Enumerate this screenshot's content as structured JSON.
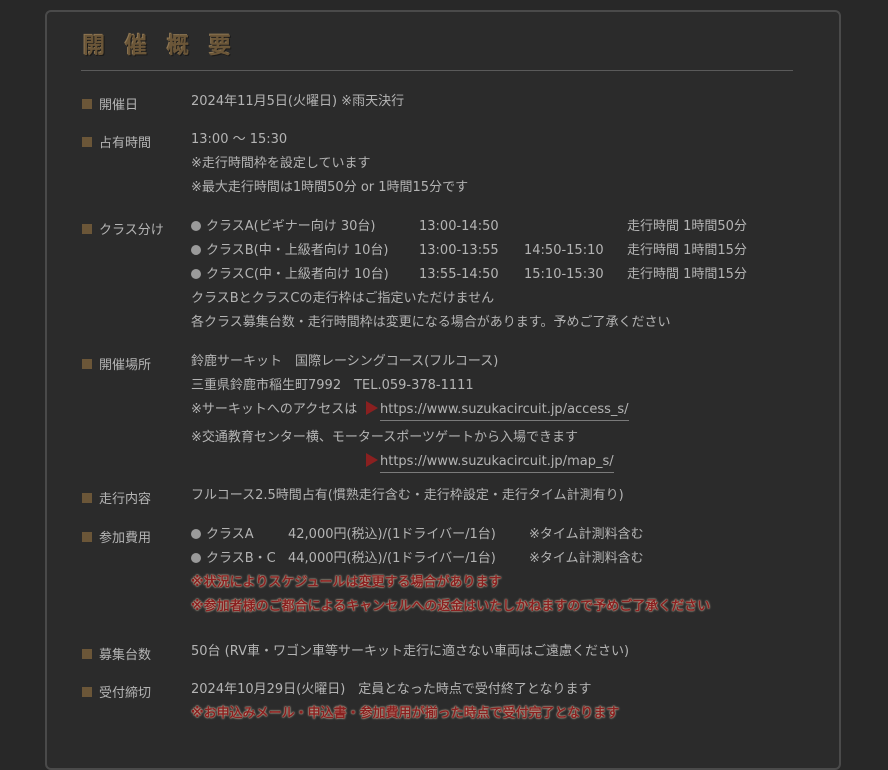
{
  "title": "開催概要",
  "sections": {
    "date": {
      "label": "開催日",
      "value": "2024年11月5日(火曜日) ※雨天決行"
    },
    "time": {
      "label": "占有時間",
      "lines": [
        "13:00 ～ 15:30",
        "※走行時間枠を設定しています",
        "※最大走行時間は1時間50分 or 1時間15分です"
      ]
    },
    "classes": {
      "label": "クラス分け",
      "rows": [
        {
          "name": "クラスA(ビギナー向け 30台)",
          "slot1": "13:00-14:50",
          "slot2": "",
          "duration": "走行時間 1時間50分"
        },
        {
          "name": "クラスB(中・上級者向け 10台)",
          "slot1": "13:00-13:55",
          "slot2": "14:50-15:10",
          "duration": "走行時間 1時間15分"
        },
        {
          "name": "クラスC(中・上級者向け 10台)",
          "slot1": "13:55-14:50",
          "slot2": "15:10-15:30",
          "duration": "走行時間 1時間15分"
        }
      ],
      "note1": "クラスBとクラスCの走行枠はご指定いただけません",
      "note2": "各クラス募集台数・走行時間枠は変更になる場合があります。予めご了承ください"
    },
    "venue": {
      "label": "開催場所",
      "line1": "鈴鹿サーキット　国際レーシングコース(フルコース)",
      "line2": "三重県鈴鹿市稲生町7992　TEL.059-378-1111",
      "access_prefix": "※サーキットへのアクセスは",
      "access_link": "https://www.suzukacircuit.jp/access_s/",
      "gate_note": "※交通教育センター横、モータースポーツゲートから入場できます",
      "map_link": "https://www.suzukacircuit.jp/map_s/"
    },
    "content": {
      "label": "走行内容",
      "value": "フルコース2.5時間占有(慣熟走行含む・走行枠設定・走行タイム計測有り)"
    },
    "fee": {
      "label": "参加費用",
      "rows": [
        {
          "name": "クラスA",
          "price": "42,000円(税込)/(1ドライバー/1台)",
          "note": "※タイム計測料含む"
        },
        {
          "name": "クラスB・C",
          "price": "44,000円(税込)/(1ドライバー/1台)",
          "note": "※タイム計測料含む"
        }
      ],
      "warn1": "※状況によりスケジュールは変更する場合があります",
      "warn2": "※参加者様のご都合によるキャンセルへの返金はいたしかねますので予めご了承ください"
    },
    "capacity": {
      "label": "募集台数",
      "value": "50台 (RV車・ワゴン車等サーキット走行に適さない車両はご遠慮ください)"
    },
    "deadline": {
      "label": "受付締切",
      "value": "2024年10月29日(火曜日)　定員となった時点で受付終了となります",
      "warn": "※お申込みメール・申込書・参加費用が揃った時点で受付完了となります"
    }
  },
  "colors": {
    "accent": "#6b5638",
    "warning": "#8a2020",
    "background": "#282828"
  }
}
